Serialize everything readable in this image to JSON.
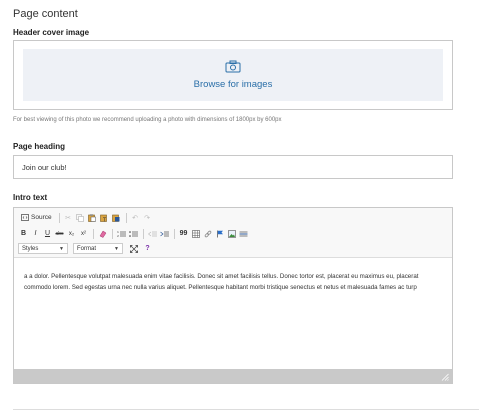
{
  "page": {
    "title": "Page content"
  },
  "cover": {
    "label": "Header cover image",
    "browse_label": "Browse for images",
    "icon": "camera-icon",
    "hint": "For best viewing of this photo we recommend uploading a photo with dimensions of 1800px by 600px"
  },
  "heading": {
    "label": "Page heading",
    "value": "Join our club!"
  },
  "intro": {
    "label": "Intro text",
    "toolbar": {
      "source_label": "Source",
      "bold_label": "B",
      "italic_label": "I",
      "underline_label": "U",
      "strike_label": "abc",
      "subscript_label": "x₂",
      "superscript_label": "x²",
      "blockquote_label": "99",
      "help_label": "?",
      "styles_label": "Styles",
      "format_label": "Format"
    },
    "content": "a a dolor. Pellentesque volutpat malesuada enim vitae facilisis. Donec sit amet facilisis tellus. Donec tortor est, placerat eu maximus eu, placerat commodo lorem. Sed egestas urna nec nulla varius aliquet. Pellentesque habitant morbi tristique senectus et netus et malesuada fames ac turp"
  },
  "colors": {
    "accent": "#2a6fa8",
    "border": "#c8c8c8",
    "dropzone_bg": "#eef1f6",
    "statusbar": "#c9c9c9"
  }
}
